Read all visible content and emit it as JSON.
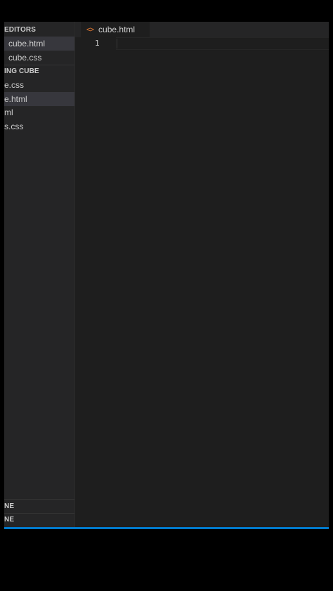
{
  "sidebar": {
    "open_editors_header": "EDITORS",
    "open_editors": [
      {
        "label": "cube.html",
        "active": true
      },
      {
        "label": "cube.css",
        "active": false
      }
    ],
    "project_header": "ING CUBE",
    "project_files": [
      {
        "label": "e.css",
        "active": false
      },
      {
        "label": "e.html",
        "active": true
      },
      {
        "label": "ml",
        "active": false
      },
      {
        "label": "s.css",
        "active": false
      }
    ],
    "bottom_sections": [
      {
        "label": "NE"
      },
      {
        "label": "NE"
      }
    ]
  },
  "editor": {
    "tab": {
      "icon": "html-code-icon",
      "label": "cube.html"
    },
    "line_numbers": [
      "1"
    ]
  },
  "colors": {
    "accent": "#007acc",
    "html_icon": "#e37933",
    "background": "#1e1e1e",
    "sidebar": "#252526"
  }
}
